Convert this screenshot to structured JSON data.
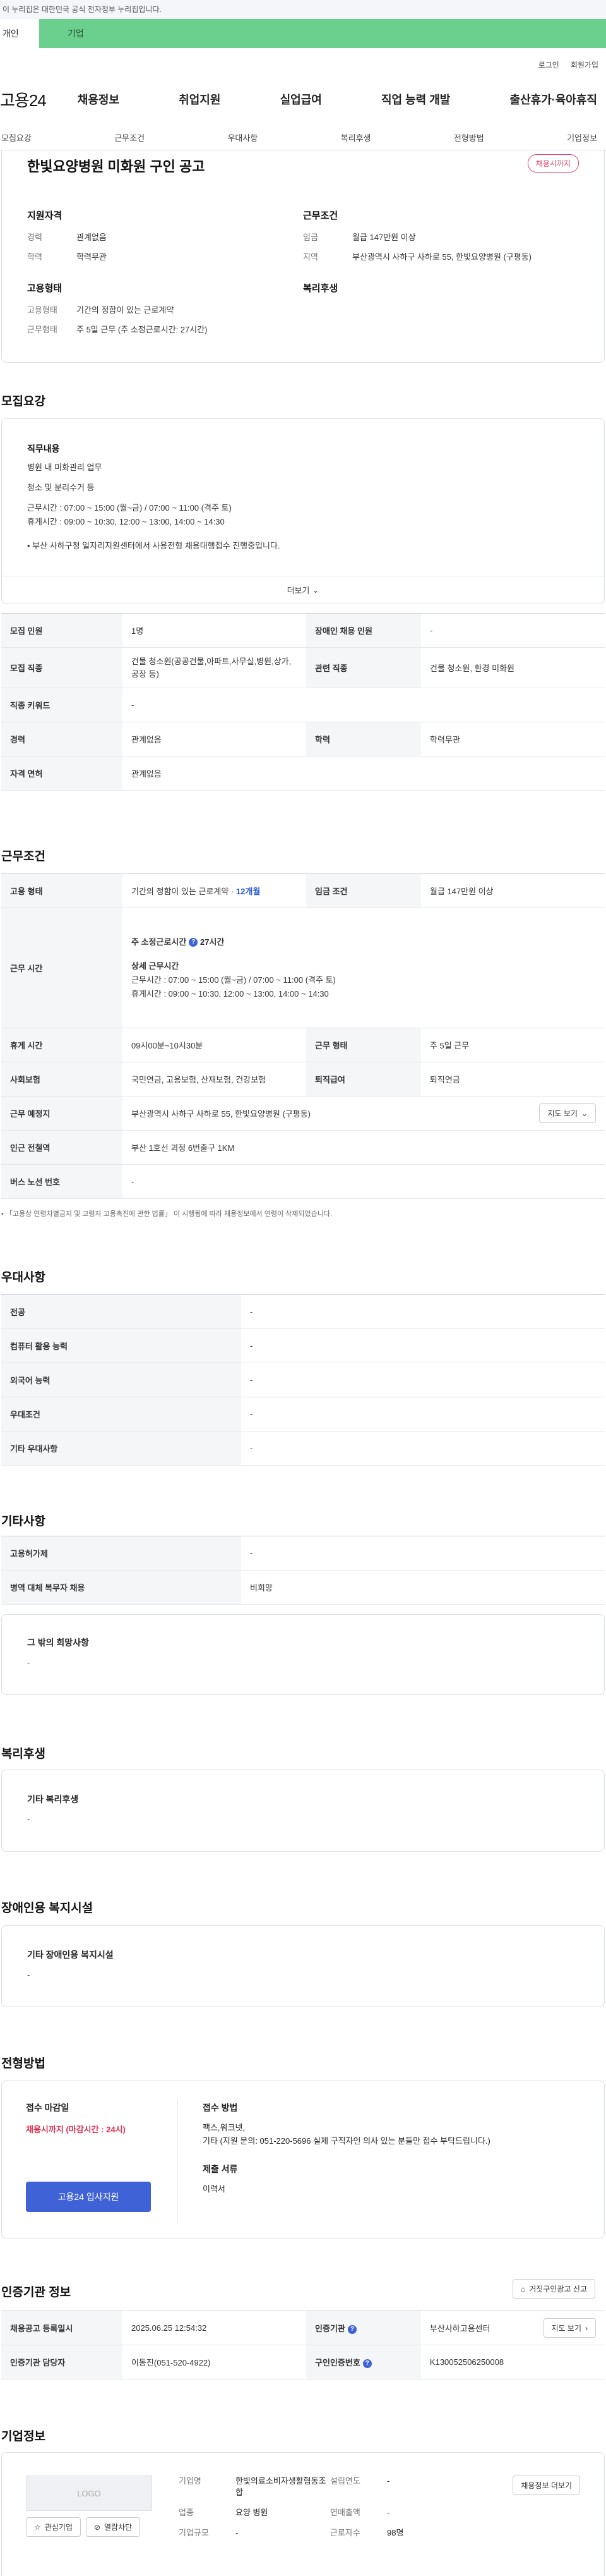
{
  "notice": "이 누리집은 대한민국 공식 전자정부 누리집입니다.",
  "gnb_tabs": {
    "personal": "개인",
    "company": "기업"
  },
  "util": {
    "login": "로그인",
    "signup": "회원가입"
  },
  "logo": "고용24",
  "main_menu": [
    "채용정보",
    "취업지원",
    "실업급여",
    "직업 능력 개발",
    "출산휴가·육아휴직"
  ],
  "sub_menu": [
    "모집요강",
    "근무조건",
    "우대사항",
    "복리후생",
    "전형방법",
    "기업정보"
  ],
  "job": {
    "title": "한빛요양병원 미화원 구인 공고",
    "status": "채용시까지",
    "qual_title": "지원자격",
    "qual": [
      {
        "k": "경력",
        "v": "관계없음"
      },
      {
        "k": "학력",
        "v": "학력무관"
      }
    ],
    "cond_title": "근무조건",
    "cond": [
      {
        "k": "임금",
        "v": "월급 147만원 이상"
      },
      {
        "k": "지역",
        "v": "부산광역시 사하구 사하로 55, 한빛요양병원 (구평동)"
      }
    ],
    "type_title": "고용형태",
    "type": [
      {
        "k": "고용형태",
        "v": "기간의 정함이 있는 근로계약"
      },
      {
        "k": "근무형태",
        "v": "주 5일 근무 (주 소정근로시간: 27시간)"
      }
    ],
    "welfare_title": "복리후생"
  },
  "recruit": {
    "heading": "모집요강",
    "desc_title": "직무내용",
    "lines": [
      "병원 내 미화관리 업무",
      "",
      "청소 및 분리수거 등",
      "",
      "근무시간 : 07:00 ~ 15:00 (월~금) / 07:00 ~ 11:00 (격주 토)",
      "휴게시간 : 09:00 ~ 10:30, 12:00 ~ 13:00, 14:00 ~ 14:30",
      "",
      "",
      "• 부산 사하구청 일자리지원센터에서 사용전형 채용대행접수 진행중입니다."
    ],
    "more": "더보기",
    "table": [
      [
        "모집 인원",
        "1명",
        "장애인 채용 인원",
        "-"
      ],
      [
        "모집 직종",
        "건물 청소원(공공건물,아파트,사무실,병원,상가,공장 등)",
        "관련 직종",
        "건물 청소원, 환경 미화원"
      ],
      [
        "직종 키워드",
        "-"
      ],
      [
        "경력",
        "관계없음",
        "학력",
        "학력무관"
      ],
      [
        "자격 면허",
        "관계없음"
      ]
    ]
  },
  "work": {
    "heading": "근무조건",
    "emp_type_k": "고용 형태",
    "emp_type_v": "기간의 정함이 있는 근로계약 · ",
    "emp_type_period": "12개월",
    "wage_k": "임금 조건",
    "wage_v": "월급 147만원 이상",
    "hours_k": "근무 시간",
    "weekly_label": "주 소정근로시간",
    "weekly_value": "27시간",
    "detail_title": "상세 근무시간",
    "detail_lines": [
      "근무시간 : 07:00 ~ 15:00 (월~금) / 07:00 ~ 11:00 (격주 토)",
      "휴게시간 : 09:00 ~ 10:30, 12:00 ~ 13:00, 14:00 ~ 14:30"
    ],
    "rest_k": "휴게 시간",
    "rest_v": "09시00분~10시30분",
    "form_k": "근무 형태",
    "form_v": "주 5일 근무",
    "ins_k": "사회보험",
    "ins_v": "국민연금, 고용보험, 산재보험, 건강보험",
    "sev_k": "퇴직급여",
    "sev_v": "퇴직연금",
    "place_k": "근무 예정지",
    "place_v": "부산광역시 사하구 사하로 55, 한빛요양병원 (구평동)",
    "map_btn": "지도 보기",
    "subway_k": "인근 전철역",
    "subway_v": "부산 1호선 괴정 6번출구 1KM",
    "bus_k": "버스 노선 번호",
    "bus_v": "-",
    "footnote": "「고용상 연령차별금지 및 고령자 고용촉진에 관한 법률」 이 시행됨에 따라 채용정보에서 연령이 삭제되었습니다."
  },
  "pref": {
    "heading": "우대사항",
    "rows": [
      [
        "전공",
        "-"
      ],
      [
        "컴퓨터 활용 능력",
        "-"
      ],
      [
        "외국어 능력",
        "-"
      ],
      [
        "우대조건",
        "-"
      ],
      [
        "기타 우대사항",
        "-"
      ]
    ]
  },
  "etc": {
    "heading": "기타사항",
    "rows": [
      [
        "고용허가제",
        "-"
      ],
      [
        "병역 대체 복무자 채용",
        "비희망"
      ]
    ],
    "hope_title": "그 밖의 희망사항",
    "hope_value": "-"
  },
  "welfare": {
    "heading": "복리후생",
    "title": "기타 복리후생",
    "value": "-"
  },
  "disabled": {
    "heading": "장애인용 복지시설",
    "title": "기타 장애인용 복지시설",
    "value": "-"
  },
  "selection": {
    "heading": "전형방법",
    "deadline_title": "접수 마감일",
    "deadline_value": "채용시까지 (마감시간 : 24시)",
    "apply_btn": "고용24 입사지원",
    "method_title": "접수 방법",
    "method_lines": [
      "팩스,워크넷,",
      "기타 (지원 문의: 051-220-5696 실제 구직자인 의사 있는 분들만 접수 부탁드립니다.)"
    ],
    "docs_title": "제출 서류",
    "docs_value": "이력서"
  },
  "cert": {
    "heading": "인증기관 정보",
    "report_btn": "거짓구인광고 신고",
    "rows": [
      [
        "채용공고 등록일시",
        "2025.06.25 12:54:32",
        "인증기관",
        "부산사하고용센터",
        "지도 보기"
      ],
      [
        "인증기관 담당자",
        "이동진(051-520-4922)",
        "구인인증번호",
        "K130052506250008"
      ]
    ]
  },
  "company": {
    "heading": "기업정보",
    "logo_text": "LOGO",
    "fav_btn": "관심기업",
    "block_btn": "열람차단",
    "rows": [
      [
        "기업명",
        "한빛의료소비자생활협동조합",
        "설립연도",
        "-"
      ],
      [
        "업종",
        "요양 병원",
        "연매출액",
        "-"
      ],
      [
        "기업규모",
        "-",
        "근로자수",
        "98명"
      ]
    ],
    "jobs_btn": "채용정보 더보기"
  }
}
